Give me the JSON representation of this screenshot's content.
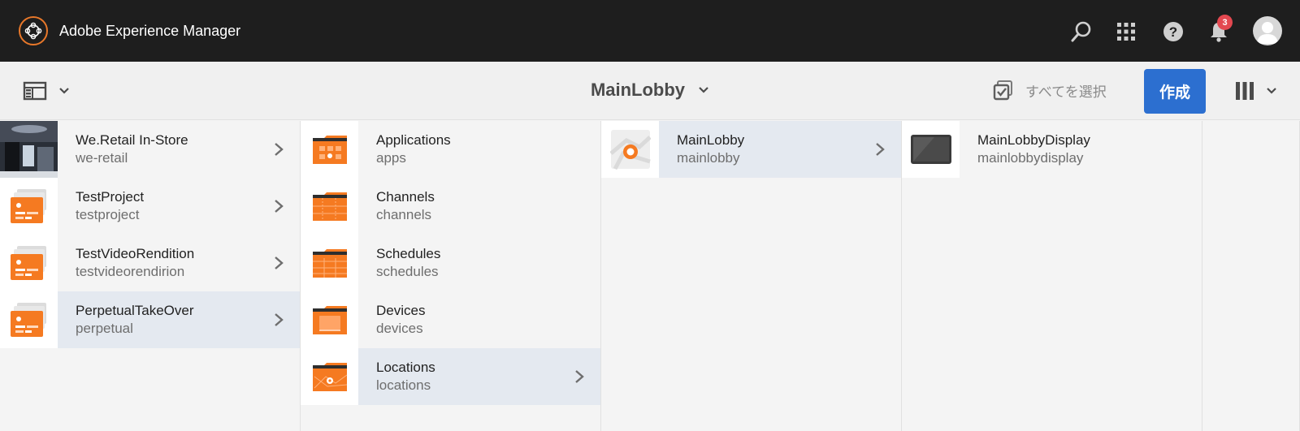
{
  "shell": {
    "app_title": "Adobe Experience Manager",
    "notification_count": "3",
    "icons": [
      "search-icon",
      "apps-grid-icon",
      "help-icon",
      "bell-icon",
      "user-avatar"
    ]
  },
  "actionbar": {
    "breadcrumb_title": "MainLobby",
    "select_all_label": "すべてを選択",
    "create_label": "作成"
  },
  "colors": {
    "shell_bg": "#1e1e1e",
    "accent_orange": "#f57a21",
    "primary_blue": "#2c6fd0",
    "active_row": "#e4e9f0",
    "badge_red": "#e34850"
  },
  "columns": [
    {
      "items": [
        {
          "title": "We.Retail In-Store",
          "name": "we-retail",
          "thumb": "photo",
          "has_children": true,
          "active": false
        },
        {
          "title": "TestProject",
          "name": "testproject",
          "thumb": "project",
          "has_children": true,
          "active": false
        },
        {
          "title": "TestVideoRendition",
          "name": "testvideorendirion",
          "thumb": "project",
          "has_children": true,
          "active": false
        },
        {
          "title": "PerpetualTakeOver",
          "name": "perpetual",
          "thumb": "project",
          "has_children": true,
          "active": true
        }
      ]
    },
    {
      "items": [
        {
          "title": "Applications",
          "name": "apps",
          "thumb": "folder-apps",
          "has_children": false,
          "active": false
        },
        {
          "title": "Channels",
          "name": "channels",
          "thumb": "folder-channels",
          "has_children": false,
          "active": false
        },
        {
          "title": "Schedules",
          "name": "schedules",
          "thumb": "folder-schedules",
          "has_children": false,
          "active": false
        },
        {
          "title": "Devices",
          "name": "devices",
          "thumb": "folder-devices",
          "has_children": false,
          "active": false
        },
        {
          "title": "Locations",
          "name": "locations",
          "thumb": "folder-locations",
          "has_children": true,
          "active": true
        }
      ]
    },
    {
      "items": [
        {
          "title": "MainLobby",
          "name": "mainlobby",
          "thumb": "location-pin",
          "has_children": true,
          "active": true
        }
      ]
    },
    {
      "items": [
        {
          "title": "MainLobbyDisplay",
          "name": "mainlobbydisplay",
          "thumb": "display",
          "has_children": false,
          "active": false
        }
      ]
    }
  ]
}
